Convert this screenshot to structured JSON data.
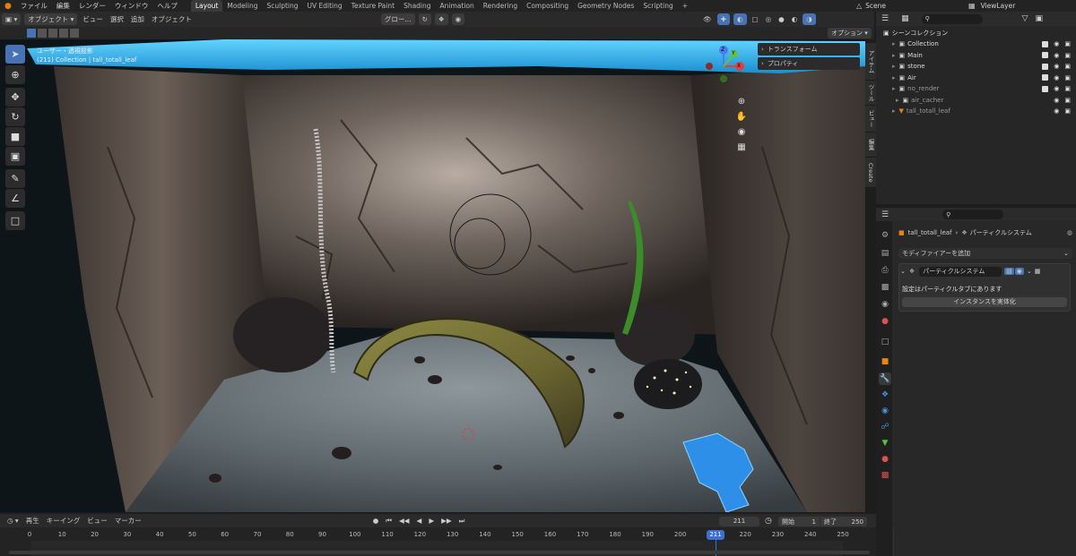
{
  "topbar": {
    "menus": [
      "ファイル",
      "編集",
      "レンダー",
      "ウィンドウ",
      "ヘルプ"
    ],
    "workspaces": [
      "Layout",
      "Modeling",
      "Sculpting",
      "UV Editing",
      "Texture Paint",
      "Shading",
      "Animation",
      "Rendering",
      "Compositing",
      "Geometry Nodes",
      "Scripting"
    ],
    "active_workspace": "Layout",
    "scene": "Scene",
    "viewlayer": "ViewLayer"
  },
  "viewport_header": {
    "mode": "オブジェクト",
    "menus": [
      "ビュー",
      "選択",
      "追加",
      "オブジェクト"
    ],
    "orientation": "グロー...",
    "options": "オプション"
  },
  "viewport": {
    "view_name": "ユーザー・透視投影",
    "collection_info": "(211) Collection | tall_totall_leaf",
    "n_panel_items": [
      "トランスフォーム",
      "プロパティ"
    ],
    "side_tabs": [
      "アイテム",
      "ツール",
      "ビュー",
      "編集",
      "Create"
    ],
    "gizmo_labels": [
      "X",
      "Y",
      "Z"
    ]
  },
  "outliner": {
    "title": "シーンコレクション",
    "rows": [
      {
        "name": "Collection",
        "indent": 1,
        "checked": true
      },
      {
        "name": "Main",
        "indent": 1,
        "checked": true
      },
      {
        "name": "stone",
        "indent": 1,
        "checked": true
      },
      {
        "name": "Air",
        "indent": 1,
        "checked": true
      },
      {
        "name": "no_render",
        "indent": 1,
        "checked": true
      },
      {
        "name": "air_cacher",
        "indent": 2,
        "checked": false
      },
      {
        "name": "tall_totall_leaf",
        "indent": 1,
        "checked": false
      }
    ]
  },
  "properties": {
    "object": "tall_totall_leaf",
    "context": "パーティクルシステム",
    "add_modifier": "モディファイアーを追加",
    "modifier_name": "パーティクルシステム",
    "info_text": "設定はパーティクルタブにあります",
    "button": "インスタンスを実体化"
  },
  "timeline": {
    "menus": [
      "再生",
      "キーイング",
      "ビュー",
      "マーカー"
    ],
    "current_frame": "211",
    "start_label": "開始",
    "start": "1",
    "end_label": "終了",
    "end": "250",
    "ticks": [
      "0",
      "10",
      "20",
      "30",
      "40",
      "50",
      "60",
      "70",
      "80",
      "90",
      "100",
      "110",
      "120",
      "130",
      "140",
      "150",
      "160",
      "170",
      "180",
      "190",
      "200",
      "211",
      "220",
      "230",
      "240",
      "250"
    ]
  },
  "colors": {
    "accent": "#4772b3",
    "frame_marker": "#3b6fd1",
    "water": "#2fb8f0",
    "rock": "#5e544e",
    "ground": "#6b7479",
    "leaf": "#7a7a36"
  }
}
